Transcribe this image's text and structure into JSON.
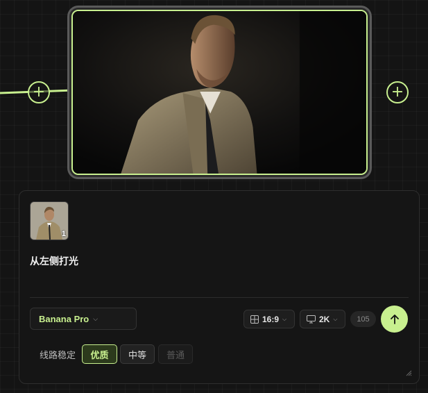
{
  "node": {
    "left_plus_icon": "plus-icon",
    "right_plus_icon": "plus-icon",
    "image_alt": "man in trench coat portrait"
  },
  "panel": {
    "reference_count": "1",
    "prompt": "从左侧打光",
    "model": {
      "label": "Banana Pro",
      "icon": "chevron-down-icon"
    },
    "aspect_ratio": {
      "label": "16:9",
      "icon": "grid-icon"
    },
    "resolution": {
      "label": "2K",
      "icon": "monitor-icon"
    },
    "credits": "105",
    "send_icon": "arrow-up-icon",
    "line": {
      "label": "线路稳定",
      "options": [
        "优质",
        "中等",
        "普通"
      ],
      "selected": "优质"
    }
  },
  "colors": {
    "accent": "#c8f08f",
    "background": "#141414",
    "panel": "#151515"
  }
}
